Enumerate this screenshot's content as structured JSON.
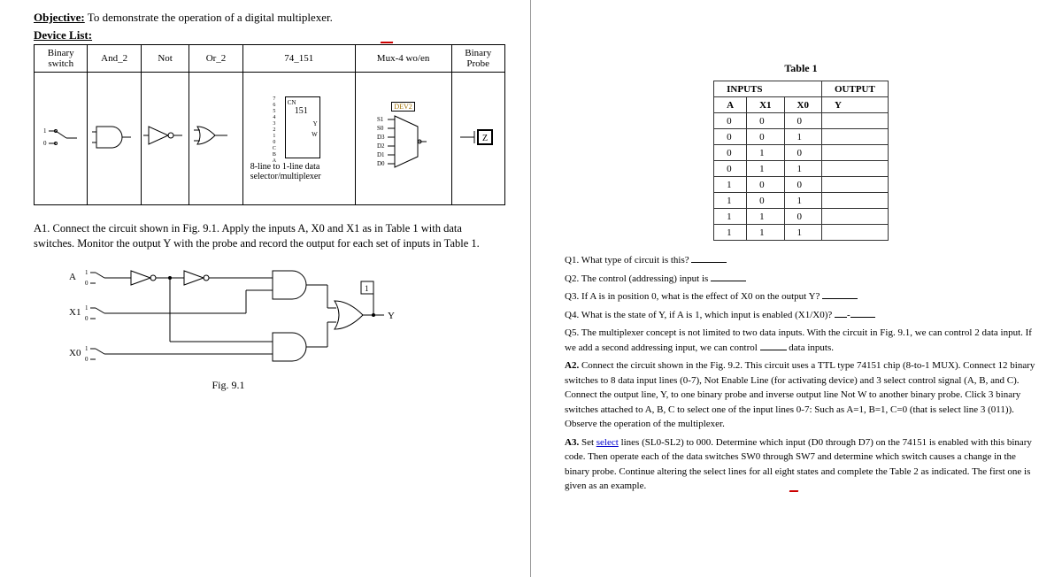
{
  "left": {
    "objective_label": "Objective:",
    "objective_text": " To demonstrate the operation of a digital multiplexer.",
    "device_list_label": "Device List:",
    "headers": [
      "Binary switch",
      "And_2",
      "Not",
      "Or_2",
      "74_151",
      "Mux-4 wo/en",
      "Binary Probe"
    ],
    "chip": {
      "name": "151",
      "pins": "7\n6\n5\n4\n3\n2\n1\n0\nC\nB\nA",
      "cn": "CN",
      "y": "Y",
      "w": "W"
    },
    "chip_caption": "8-line to 1-line data selector/multiplexer",
    "mux_label": "DEV2",
    "mux_pins": [
      "S1",
      "S0",
      "D3",
      "D2",
      "D1",
      "D0"
    ],
    "probe_label": "Z",
    "a1": "A1. Connect the circuit shown in Fig. 9.1. Apply the inputs A, X0 and X1 as in Table 1 with data switches. Monitor the output Y with the probe and record the output for each set of inputs in Table 1.",
    "inputs": [
      "A",
      "X1",
      "X0"
    ],
    "fig_caption": "Fig. 9.1",
    "probe_value": "1",
    "output_label": "Y"
  },
  "right": {
    "table_caption": "Table 1",
    "hdr_inputs": "INPUTS",
    "hdr_output": "OUTPUT",
    "cols": [
      "A",
      "X1",
      "X0",
      "Y"
    ],
    "rows": [
      [
        "0",
        "0",
        "0",
        ""
      ],
      [
        "0",
        "0",
        "1",
        ""
      ],
      [
        "0",
        "1",
        "0",
        ""
      ],
      [
        "0",
        "1",
        "1",
        ""
      ],
      [
        "1",
        "0",
        "0",
        ""
      ],
      [
        "1",
        "0",
        "1",
        ""
      ],
      [
        "1",
        "1",
        "0",
        ""
      ],
      [
        "1",
        "1",
        "1",
        ""
      ]
    ],
    "q1": "Q1. What type of circuit is this?",
    "q2": "Q2. The control (addressing) input is",
    "q3": "Q3. If A is in position 0, what is the effect of X0 on the output Y?",
    "q4": "Q4. What is the state of Y, if A is 1, which input is enabled (X1/X0)?",
    "q5a": "Q5. The multiplexer concept is not limited to two data inputs. With the circuit in Fig. 9.1, we can control 2 data input. If we add a second addressing input, we can control",
    "q5b": " data inputs.",
    "a2": " Connect the circuit shown in the Fig. 9.2. This circuit uses a TTL type 74151 chip (8-to-1 MUX). Connect 12 binary switches to 8 data input lines (0-7), Not Enable Line (for activating device) and 3 select control signal (A, B, and C). Connect the output line, Y, to one binary probe and inverse output line Not W to another binary probe. Click 3 binary switches attached to A, B, C to select one of the input lines 0-7: Such as A=1, B=1, C=0 (that is select line 3 (011)). Observe the operation of the multiplexer.",
    "a2_label": "A2.",
    "a3a": " Set ",
    "a3_label": "A3.",
    "a3_select": "select",
    "a3b": " lines (SL0-SL2) to 000. Determine which input (D0 through D7) on the 74151 is enabled with this binary code. Then operate each of the data switches SW0 through SW7 and determine which switch causes a change in the binary probe. Continue altering the select lines for all eight states and complete the Table 2 as indicated. The first one is given as an example."
  }
}
